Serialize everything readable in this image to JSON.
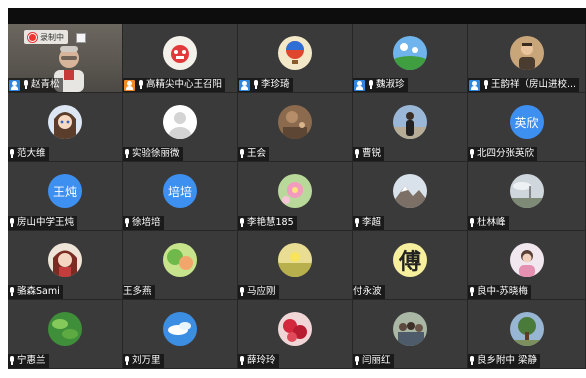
{
  "recording": {
    "label": "录制中"
  },
  "colors": {
    "tile_bg": "#3a3a3a",
    "host_blue": "#2d86e0",
    "host_orange": "#f08a24",
    "text_avatar_blue": "#3d8ff0"
  },
  "participants": [
    {
      "name": "赵青松",
      "host": "blue",
      "video": true
    },
    {
      "name": "高精尖中心王召阳",
      "host": "orange",
      "avatar": "red-cartoon-face"
    },
    {
      "name": "李珍琦",
      "host": "blue",
      "avatar": "hot-air-balloon"
    },
    {
      "name": "魏淑珍",
      "host": "blue",
      "avatar": "landscape-sky"
    },
    {
      "name": "王韵祥（房山进校...",
      "host": "blue",
      "avatar": "man-portrait"
    },
    {
      "name": "范大维",
      "avatar": "anime-character"
    },
    {
      "name": "实验徐丽微",
      "avatar": "default-person"
    },
    {
      "name": "王会",
      "avatar": "brown-photo"
    },
    {
      "name": "曹锐",
      "avatar": "person-outdoor"
    },
    {
      "name": "北四分张英欣",
      "avatar_text": "英欣"
    },
    {
      "name": "房山中学王炖",
      "avatar_text": "王炖"
    },
    {
      "name": "徐培培",
      "avatar_text": "培培"
    },
    {
      "name": "李艳慧185",
      "avatar": "flower-pink"
    },
    {
      "name": "李超",
      "avatar": "mountain-photo"
    },
    {
      "name": "杜林峰",
      "avatar": "cloudy-landscape"
    },
    {
      "name": "骆森Sami",
      "avatar": "girl-dark-hair"
    },
    {
      "name": "王多燕",
      "mic": false,
      "avatar": "green-plant-photo"
    },
    {
      "name": "马应刚",
      "avatar": "yellow-flower-field"
    },
    {
      "name": "付永波",
      "mic": false,
      "avatar": "calligraphy-character"
    },
    {
      "name": "良中-苏晓梅",
      "avatar": "woman-pink"
    },
    {
      "name": "宁惠兰",
      "avatar": "green-leaves"
    },
    {
      "name": "刘万里",
      "avatar": "blue-sky-cloud"
    },
    {
      "name": "薛玲玲",
      "avatar": "red-roses"
    },
    {
      "name": "闫丽红",
      "avatar": "group-photo"
    },
    {
      "name": "良乡附中 梁静",
      "avatar": "tree-landscape"
    }
  ],
  "calligraphy_char": "傅"
}
